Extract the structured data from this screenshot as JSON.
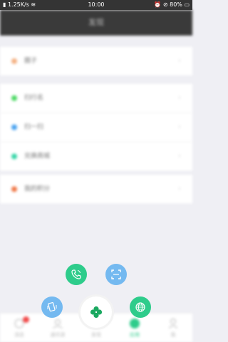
{
  "status_bar": {
    "network_speed": "1.25K/s",
    "time": "10:00",
    "battery": "80%"
  },
  "header": {
    "title": "发现"
  },
  "groups": [
    {
      "items": [
        {
          "label": "圈子",
          "dot_color": "#f4b183"
        }
      ]
    },
    {
      "items": [
        {
          "label": "扫行名",
          "dot_color": "#4cd964"
        },
        {
          "label": "扫一扫",
          "dot_color": "#4aa3f0"
        },
        {
          "label": "兑换商城",
          "dot_color": "#37d6a8"
        }
      ]
    },
    {
      "items": [
        {
          "label": "我的积分",
          "dot_color": "#f07a4a"
        }
      ]
    }
  ],
  "tabbar": {
    "items": [
      {
        "label": "消息"
      },
      {
        "label": "通讯录"
      },
      {
        "label": "发现"
      },
      {
        "label": "应用"
      },
      {
        "label": "我"
      }
    ]
  },
  "colors": {
    "green": "#2ecc8b",
    "blue": "#74b9f0",
    "dark": "#343434"
  }
}
